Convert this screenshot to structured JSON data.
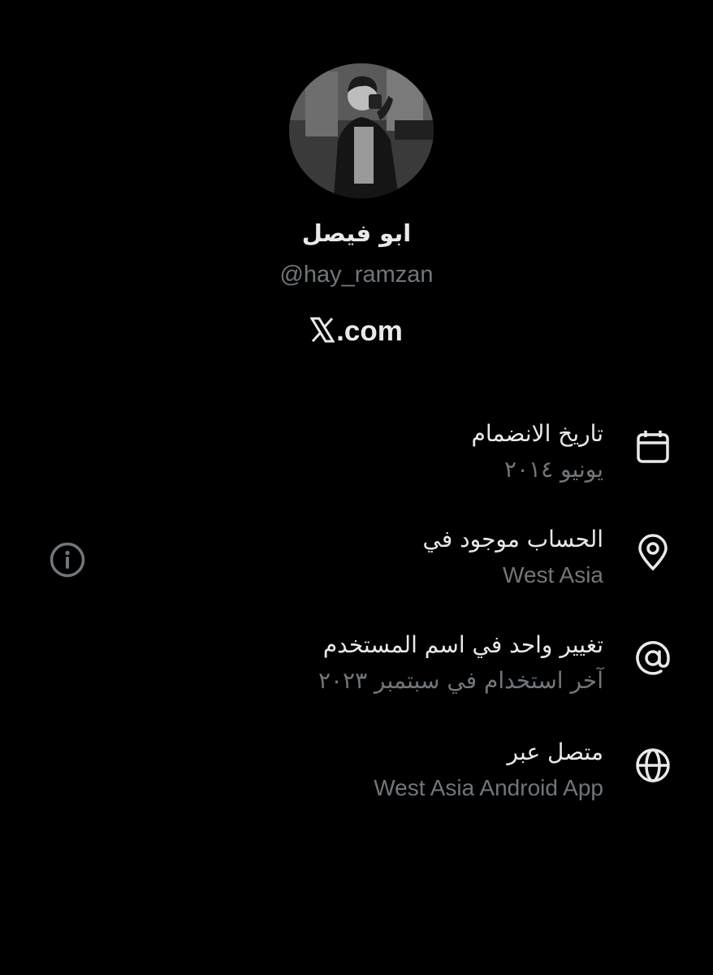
{
  "profile": {
    "display_name": "ابو فيصل",
    "handle": "@hay_ramzan",
    "brand_text": ".com",
    "brand_mark": "X"
  },
  "about": [
    {
      "icon": "calendar-icon",
      "title": "تاريخ الانضمام",
      "subtitle": "يونيو ٢٠١٤"
    },
    {
      "icon": "location-pin-icon",
      "title": "الحساب موجود في",
      "subtitle": "West Asia",
      "has_info": true
    },
    {
      "icon": "at-sign-icon",
      "title": "تغيير واحد في اسم المستخدم",
      "subtitle": "آخر استخدام في سبتمبر ٢٠٢٣"
    },
    {
      "icon": "globe-icon",
      "title": "متصل عبر",
      "subtitle": "West Asia Android App"
    }
  ],
  "colors": {
    "background": "#000000",
    "primary_text": "#e7e9ea",
    "secondary_text": "#71767b"
  }
}
